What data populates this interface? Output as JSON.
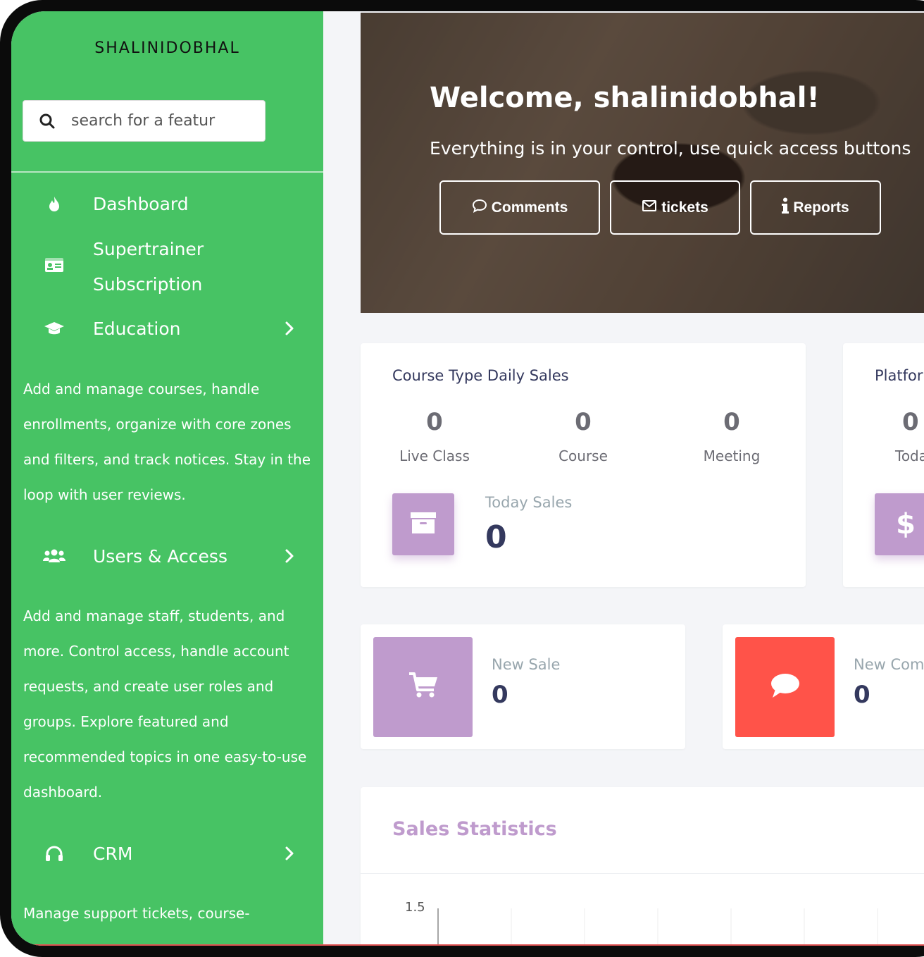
{
  "brand": "SHALINIDOBHAL",
  "search": {
    "placeholder": "search for a featur"
  },
  "nav": {
    "dashboard": "Dashboard",
    "supertrainer_line1": "Supertrainer",
    "supertrainer_line2": "Subscription",
    "education": "Education",
    "education_desc": "Add and manage courses, handle enrollments, organize with core zones and filters, and track notices. Stay in the loop with user reviews.",
    "users": "Users & Access",
    "users_desc": "Add and manage staff, students, and more. Control access, handle account requests, and create user roles and groups. Explore featured and recommended topics in one easy-to-use dashboard.",
    "crm": "CRM",
    "crm_desc": "Manage support tickets, course-"
  },
  "hero": {
    "title": "Welcome, shalinidobhal!",
    "subtitle": "Everything is in your control, use quick access buttons",
    "buttons": {
      "comments": "Comments",
      "tickets": "tickets",
      "reports": "Reports"
    }
  },
  "course_card": {
    "title": "Course Type Daily Sales",
    "stats": [
      {
        "value": "0",
        "label": "Live Class"
      },
      {
        "value": "0",
        "label": "Course"
      },
      {
        "value": "0",
        "label": "Meeting"
      }
    ],
    "today_label": "Today Sales",
    "today_value": "0"
  },
  "platform_card": {
    "title": "Platfor",
    "value": "0",
    "label": "Toda"
  },
  "new_sale": {
    "label": "New Sale",
    "value": "0"
  },
  "new_comment": {
    "label": "New Com",
    "value": "0"
  },
  "sales_stats": {
    "title": "Sales Statistics",
    "y_tick": "1.5"
  },
  "colors": {
    "sidebar": "#47c364",
    "purple": "#bf9bcd",
    "red": "#ff5349",
    "dark_text": "#34395e"
  }
}
